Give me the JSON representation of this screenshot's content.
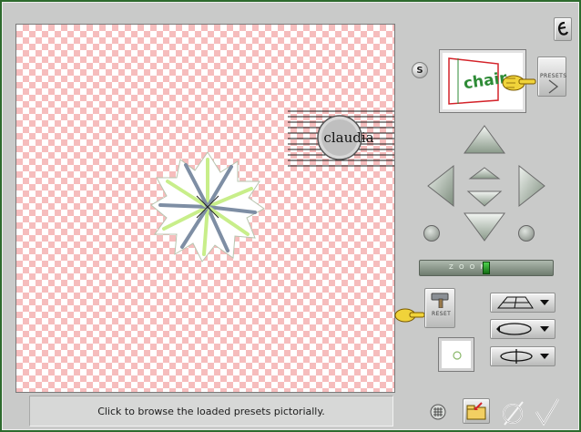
{
  "status": {
    "text": "Click to browse the loaded presets pictorially."
  },
  "preview": {
    "line1": "chair",
    "line2": "claudia"
  },
  "controls": {
    "s_label": "S",
    "presets_label": "PRESETS",
    "reset_label": "RESET",
    "zoom_label": "Z O O M",
    "zoom_level": 0.5
  },
  "colors": {
    "checker": "#f6bdbd",
    "accent_green": "#2d6a2d",
    "chair_red": "#d4232a",
    "chair_green": "#2e8b36"
  },
  "icons": {
    "app": "brand-e-icon",
    "star": "star-preview-icon",
    "hand": "pointing-hand-icon",
    "nav": [
      "arrow-up-icon",
      "arrow-left-icon",
      "arrow-right-icon",
      "arrow-down-icon",
      "center-up-icon",
      "center-down-icon"
    ],
    "rotate": [
      "rotate-left-icon",
      "rotate-right-icon"
    ],
    "shape": [
      "perspective-plane-icon",
      "rotate-loop-icon",
      "spin-loop-icon"
    ],
    "bottom": [
      "grid-icon",
      "folder-icon",
      "cancel-icon",
      "ok-icon"
    ]
  }
}
